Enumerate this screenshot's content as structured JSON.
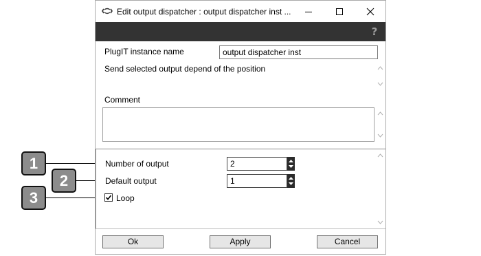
{
  "window": {
    "title": "Edit output dispatcher : output dispatcher inst ...",
    "minimize_glyph": "—",
    "maximize_glyph": "☐",
    "close_glyph": "✕"
  },
  "toolbar": {
    "help_icon": "?"
  },
  "instance": {
    "label": "PlugIT instance name",
    "value": "output dispatcher inst",
    "description": "Send selected output depend of the position"
  },
  "comment": {
    "label": "Comment",
    "value": ""
  },
  "params": {
    "number_of_output": {
      "label": "Number of output",
      "value": "2"
    },
    "default_output": {
      "label": "Default output",
      "value": "1"
    },
    "loop": {
      "label": "Loop",
      "checked": true
    }
  },
  "buttons": {
    "ok": "Ok",
    "apply": "Apply",
    "cancel": "Cancel"
  },
  "callouts": [
    "1",
    "2",
    "3"
  ]
}
